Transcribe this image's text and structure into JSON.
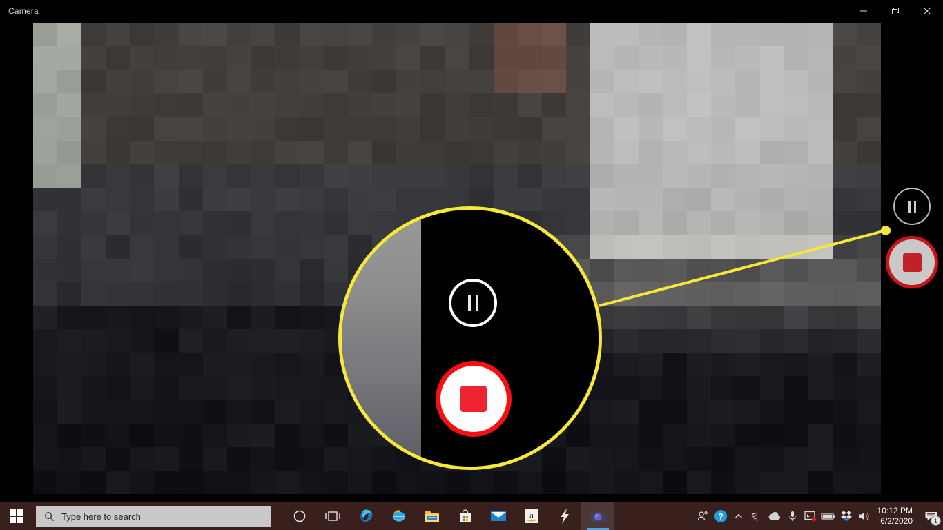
{
  "window": {
    "title": "Camera",
    "controls": [
      {
        "name": "minimize",
        "label": "Minimize"
      },
      {
        "name": "maximize",
        "label": "Restore Down"
      },
      {
        "name": "close",
        "label": "Close"
      }
    ]
  },
  "camera": {
    "state": "recording",
    "controls": {
      "pause_label": "Pause",
      "stop_label": "Stop recording"
    },
    "callout": {
      "highlight_color": "#f5e839",
      "magnified_controls": [
        "pause-video-button",
        "stop-video-button"
      ]
    },
    "accent_colors": {
      "record_red": "#cc1414",
      "stop_square": "#c4202a",
      "pause_ring": "#b9b9b9",
      "callout_yellow": "#f5e839"
    }
  },
  "taskbar": {
    "start_label": "Start",
    "search": {
      "placeholder": "Type here to search",
      "value": "Type here to search"
    },
    "items": [
      {
        "name": "cortana",
        "label": "Cortana",
        "active": false
      },
      {
        "name": "task-view",
        "label": "Task View",
        "active": false
      },
      {
        "name": "microsoft-edge",
        "label": "Microsoft Edge",
        "active": false
      },
      {
        "name": "internet-explorer",
        "label": "Internet Explorer",
        "active": false
      },
      {
        "name": "file-explorer",
        "label": "File Explorer",
        "active": false
      },
      {
        "name": "microsoft-store",
        "label": "Microsoft Store",
        "active": false
      },
      {
        "name": "mail",
        "label": "Mail",
        "active": false
      },
      {
        "name": "amazon",
        "label": "Amazon",
        "active": false
      },
      {
        "name": "lightning-app",
        "label": "Lightning",
        "active": false
      },
      {
        "name": "camera",
        "label": "Camera",
        "active": true
      }
    ],
    "tray": [
      {
        "name": "people",
        "label": "People"
      },
      {
        "name": "help",
        "label": "Help"
      },
      {
        "name": "show-hidden-icons",
        "label": "Show hidden icons"
      },
      {
        "name": "network",
        "label": "Network"
      },
      {
        "name": "onedrive",
        "label": "OneDrive"
      },
      {
        "name": "microphone",
        "label": "Microphone in use"
      },
      {
        "name": "display-alert",
        "label": "Display"
      },
      {
        "name": "battery",
        "label": "Battery"
      },
      {
        "name": "dropbox",
        "label": "Dropbox"
      },
      {
        "name": "volume",
        "label": "Volume"
      }
    ],
    "clock": {
      "time": "10:12 PM",
      "date": "6/2/2020"
    },
    "notifications": {
      "count": "1",
      "label": "Notifications"
    }
  }
}
